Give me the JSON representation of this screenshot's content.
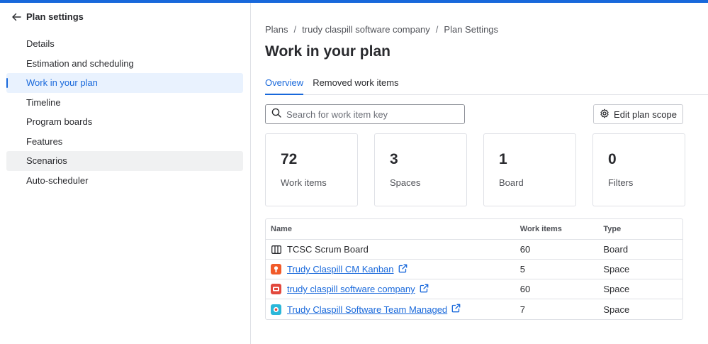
{
  "sidebar": {
    "title": "Plan settings",
    "items": [
      {
        "label": "Details"
      },
      {
        "label": "Estimation and scheduling"
      },
      {
        "label": "Work in your plan"
      },
      {
        "label": "Timeline"
      },
      {
        "label": "Program boards"
      },
      {
        "label": "Features"
      },
      {
        "label": "Scenarios"
      },
      {
        "label": "Auto-scheduler"
      }
    ],
    "active_item": "Work in your plan",
    "hovered_item": "Scenarios"
  },
  "breadcrumb": [
    "Plans",
    "trudy claspill software company",
    "Plan Settings"
  ],
  "page_title": "Work in your plan",
  "tabs": [
    {
      "label": "Overview",
      "active": true
    },
    {
      "label": "Removed work items",
      "active": false
    }
  ],
  "search": {
    "placeholder": "Search for work item key",
    "value": ""
  },
  "edit_button": {
    "label": "Edit plan scope"
  },
  "stats": [
    {
      "value": "72",
      "label": "Work items"
    },
    {
      "value": "3",
      "label": "Spaces"
    },
    {
      "value": "1",
      "label": "Board"
    },
    {
      "value": "0",
      "label": "Filters"
    }
  ],
  "table": {
    "headers": {
      "name": "Name",
      "items": "Work items",
      "type": "Type"
    },
    "rows": [
      {
        "name": "TCSC Scrum Board",
        "items": "60",
        "type": "Board",
        "icon": "board-icon",
        "link": false
      },
      {
        "name": "Trudy Claspill CM Kanban",
        "items": "5",
        "type": "Space",
        "icon": "space-avatar-orange-icon",
        "link": true
      },
      {
        "name": "trudy claspill software company",
        "items": "60",
        "type": "Space",
        "icon": "space-avatar-red-icon",
        "link": true
      },
      {
        "name": "Trudy Claspill Software Team Managed",
        "items": "7",
        "type": "Space",
        "icon": "space-avatar-teal-icon",
        "link": true
      }
    ]
  },
  "colors": {
    "accent": "#1868db",
    "active_bg": "#e9f2fe",
    "hover_bg": "#f0f1f2",
    "border": "#dfe1e6"
  }
}
